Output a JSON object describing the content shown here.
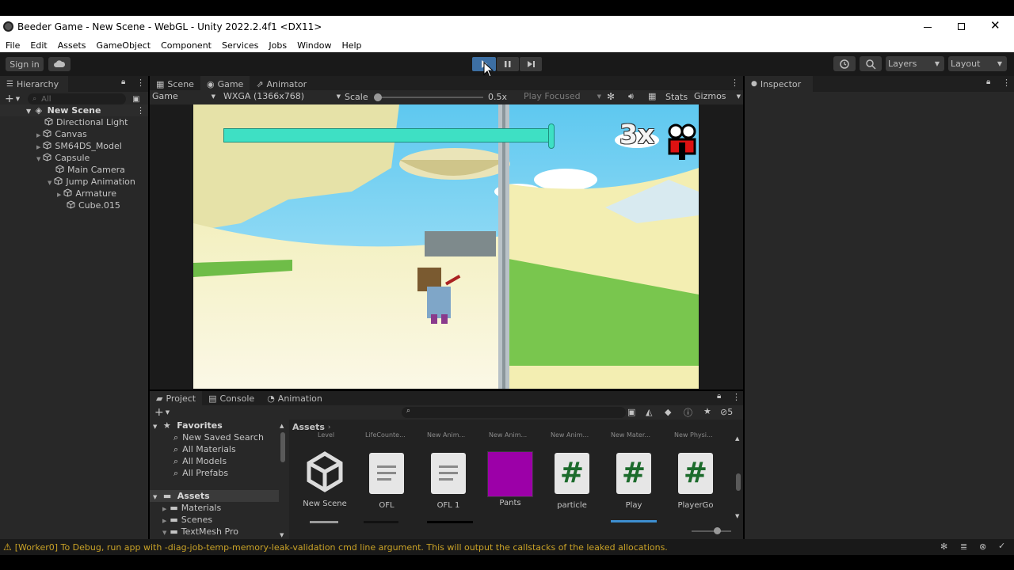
{
  "window": {
    "title": "Beeder Game - New Scene - WebGL - Unity 2022.2.4f1 <DX11>"
  },
  "menu": [
    "File",
    "Edit",
    "Assets",
    "GameObject",
    "Component",
    "Services",
    "Jobs",
    "Window",
    "Help"
  ],
  "toolbar": {
    "sign_in": "Sign in",
    "layers": "Layers",
    "layout": "Layout"
  },
  "hierarchy": {
    "tab": "Hierarchy",
    "search_placeholder": "All",
    "scene": "New Scene",
    "items": [
      "Directional Light",
      "Canvas",
      "SM64DS_Model",
      "Capsule",
      "Main Camera",
      "Jump Animation",
      "Armature",
      "Cube.015"
    ]
  },
  "center_tabs": {
    "scene": "Scene",
    "game": "Game",
    "animator": "Animator"
  },
  "game_toolbar": {
    "display": "Game",
    "resolution": "WXGA (1366x768)",
    "scale_label": "Scale",
    "scale_value": "0.5x",
    "play_mode": "Play Focused",
    "stats": "Stats",
    "gizmos": "Gizmos"
  },
  "game_view": {
    "lives": "3x",
    "health_fraction": 1.0
  },
  "inspector": {
    "tab": "Inspector"
  },
  "bottom_tabs": {
    "project": "Project",
    "console": "Console",
    "animation": "Animation"
  },
  "project": {
    "hidden_count": "5",
    "favorites_label": "Favorites",
    "favorites": [
      "New Saved Search",
      "All Materials",
      "All Models",
      "All Prefabs"
    ],
    "assets_label": "Assets",
    "folders": [
      "Materials",
      "Scenes",
      "TextMesh Pro"
    ],
    "breadcrumb": "Assets",
    "cut_labels": [
      "Level",
      "LifeCounte...",
      "New Anim...",
      "New Anim...",
      "New Anim...",
      "New Mater...",
      "New Physi..."
    ],
    "assets": [
      {
        "name": "New Scene",
        "icon": "unity-scene-icon"
      },
      {
        "name": "OFL",
        "icon": "text-file-icon"
      },
      {
        "name": "OFL 1",
        "icon": "text-file-icon"
      },
      {
        "name": "Pants",
        "icon": "material-icon"
      },
      {
        "name": "particle",
        "icon": "csharp-script-icon"
      },
      {
        "name": "Play",
        "icon": "csharp-script-icon"
      },
      {
        "name": "PlayerGo",
        "icon": "csharp-script-icon"
      }
    ]
  },
  "colors": {
    "accent_play": "#3d6fa3",
    "health_bar": "#3ee0c4",
    "material_pants": "#9c00a8",
    "warning": "#c9a227"
  },
  "status": {
    "message": "[Worker0] To Debug, run app with -diag-job-temp-memory-leak-validation cmd line argument. This will output the callstacks of the leaked allocations."
  }
}
